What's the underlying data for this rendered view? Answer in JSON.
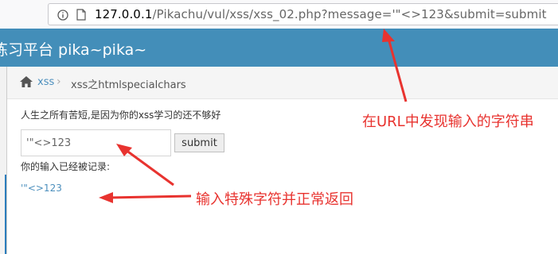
{
  "browser": {
    "url_host": "127.0.0.1",
    "url_path": "/Pikachu/vul/xss/xss_02.php?message='\"<>123&submit=submit"
  },
  "header": {
    "brand": "练习平台 pika~pika~"
  },
  "breadcrumb": {
    "link": "xss",
    "separator": "›",
    "current": "xss之htmlspecialchars"
  },
  "main": {
    "notice": "人生之所有苦短,是因为你的xss学习的还不够好",
    "input_value": "'\"<>123",
    "submit_label": "submit",
    "record_label": "你的输入已经被记录:",
    "echo_output": "'\"<>123"
  },
  "annotations": {
    "url_note": "在URL中发现输入的字符串",
    "input_note": "输入特殊字符并正常返回"
  },
  "colors": {
    "header_bg": "#438eb9",
    "link": "#4c8fbd",
    "annotation": "#e8332f"
  },
  "icons": [
    "info-icon",
    "page-icon",
    "home-icon"
  ]
}
